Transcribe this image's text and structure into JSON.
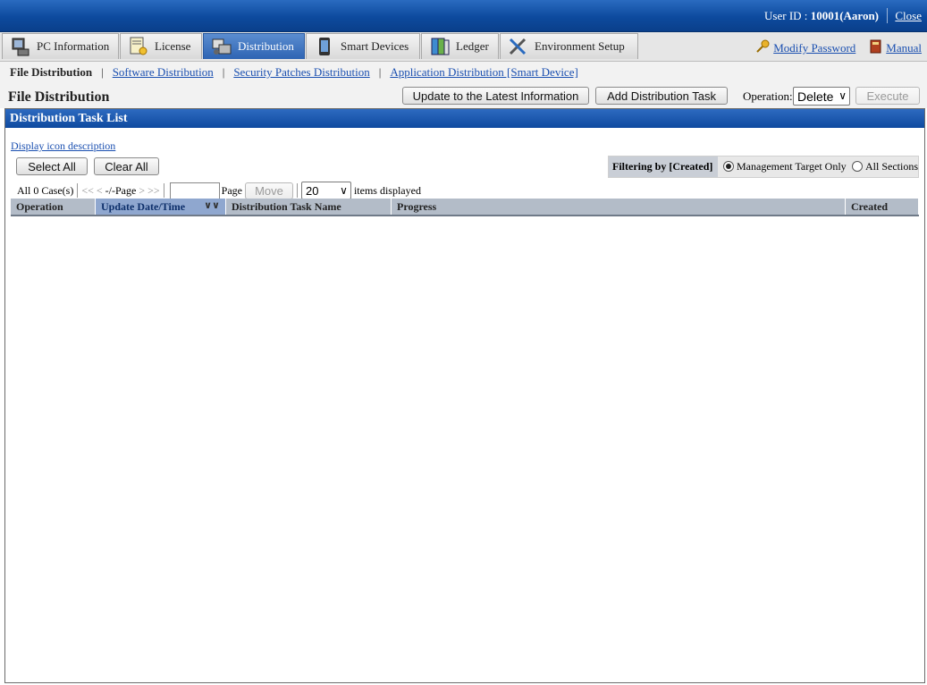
{
  "header": {
    "user_prefix": "User ID : ",
    "user_id": "10001(Aaron)",
    "close": "Close"
  },
  "tabs": [
    {
      "label": "PC Information",
      "icon": "pc-info-icon"
    },
    {
      "label": "License",
      "icon": "license-icon"
    },
    {
      "label": "Distribution",
      "icon": "distribution-icon",
      "active": true
    },
    {
      "label": "Smart Devices",
      "icon": "smart-device-icon"
    },
    {
      "label": "Ledger",
      "icon": "ledger-icon"
    },
    {
      "label": "Environment Setup",
      "icon": "tools-icon"
    }
  ],
  "top_links": {
    "modify_password": "Modify Password",
    "manual": "Manual"
  },
  "subnav": {
    "current": "File Distribution",
    "links": [
      "Software Distribution",
      "Security Patches Distribution",
      "Application Distribution [Smart Device]"
    ]
  },
  "page": {
    "title": "File Distribution",
    "update_button": "Update to the Latest Information",
    "add_button": "Add Distribution Task",
    "operation_label": "Operation:",
    "operation_value": "Delete",
    "execute_button": "Execute"
  },
  "panel": {
    "title": "Distribution Task List",
    "icon_desc_link": "Display icon description",
    "select_all": "Select All",
    "clear_all": "Clear All",
    "filter_label": "Filtering by [Created]",
    "filter_options": [
      "Management Target Only",
      "All Sections"
    ],
    "filter_selected": "Management Target Only"
  },
  "pager": {
    "count": "All 0 Case(s)",
    "first": "<<",
    "prev": "<",
    "page_state": "-/-Page",
    "next": ">",
    "last": ">>",
    "page_label": "Page",
    "move": "Move",
    "per_page": "20",
    "items_label": "items displayed"
  },
  "table": {
    "columns": [
      "Operation",
      "Update Date/Time",
      "Distribution Task Name",
      "Progress",
      "Created"
    ],
    "sorted_column": "Update Date/Time",
    "rows": []
  },
  "colors": {
    "header_blue": "#0d4a9e",
    "active_tab": "#2e64b3",
    "link": "#1a4fb0"
  }
}
